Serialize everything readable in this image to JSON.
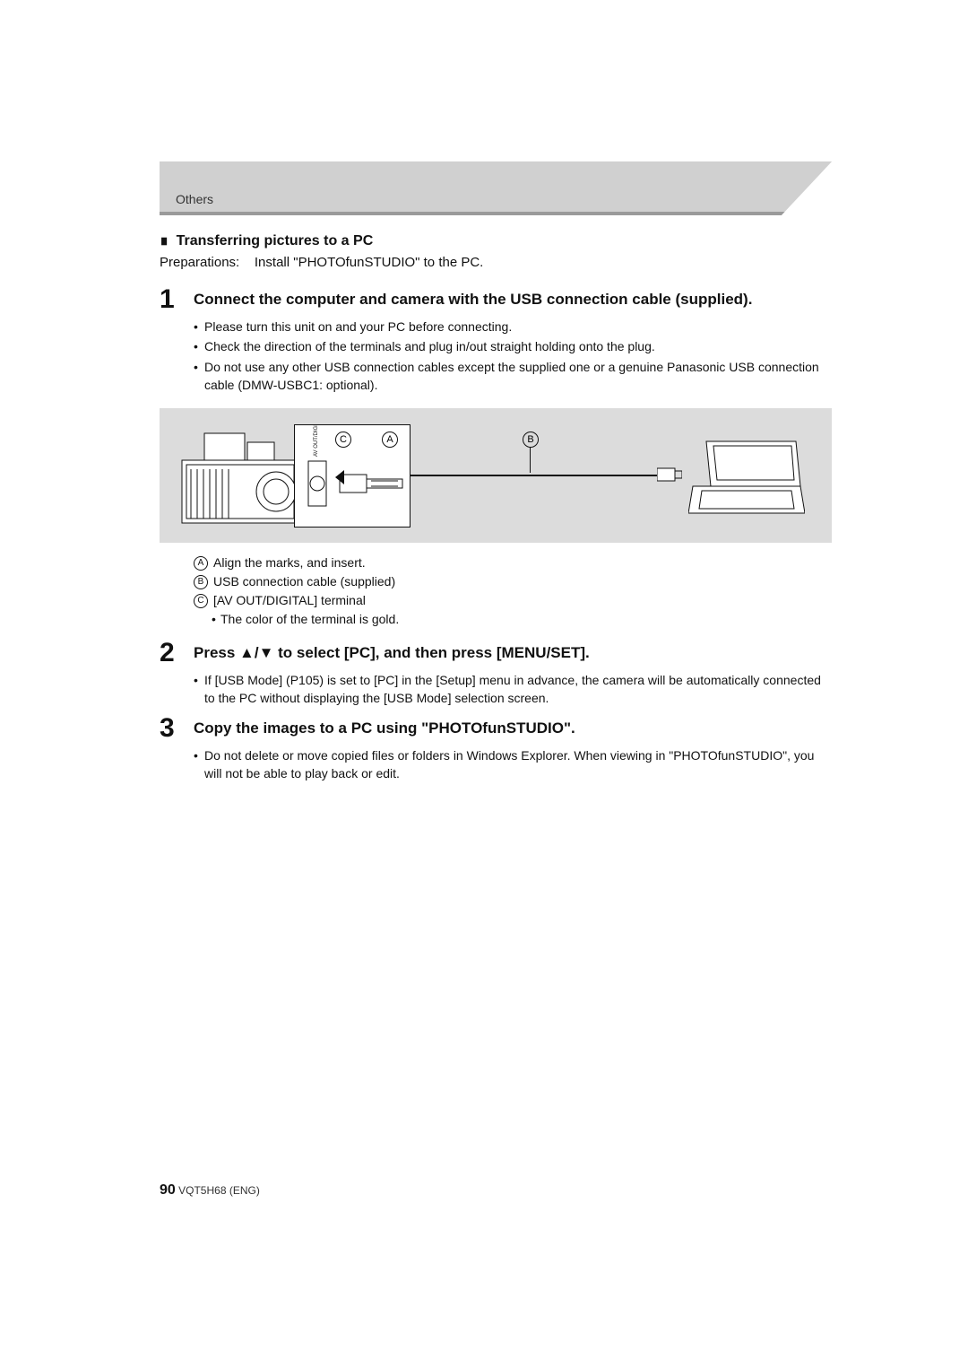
{
  "header": {
    "category": "Others"
  },
  "section_title": "Transferring pictures to a PC",
  "preparations": {
    "label": "Preparations:",
    "text": "Install \"PHOTOfunSTUDIO\" to the PC."
  },
  "steps": [
    {
      "num": "1",
      "heading": "Connect the computer and camera with the USB connection cable (supplied).",
      "bullets": [
        "Please turn this unit on and your PC before connecting.",
        "Check the direction of the terminals and plug in/out straight holding onto the plug.",
        "Do not use any other USB connection cables except the supplied one or a genuine Panasonic USB connection cable (DMW-USBC1: optional)."
      ]
    },
    {
      "num": "2",
      "heading": "Press ▲/▼ to select [PC], and then press [MENU/SET].",
      "bullets": [
        "If [USB Mode] (P105) is set to [PC] in the [Setup] menu in advance, the camera will be automatically connected to the PC without displaying the [USB Mode] selection screen."
      ]
    },
    {
      "num": "3",
      "heading": "Copy the images to a PC using \"PHOTOfunSTUDIO\".",
      "bullets": [
        "Do not delete or move copied files or folders in Windows Explorer. When viewing in \"PHOTOfunSTUDIO\", you will not be able to play back or edit."
      ]
    }
  ],
  "diagram": {
    "labels": {
      "A": "A",
      "B": "B",
      "C": "C"
    }
  },
  "annotations": [
    {
      "mark": "A",
      "text": "Align the marks, and insert."
    },
    {
      "mark": "B",
      "text": "USB connection cable (supplied)"
    },
    {
      "mark": "C",
      "text": "[AV OUT/DIGITAL] terminal"
    }
  ],
  "annotation_sub": "The color of the terminal is gold.",
  "footer": {
    "page": "90",
    "doc": "VQT5H68 (ENG)"
  }
}
